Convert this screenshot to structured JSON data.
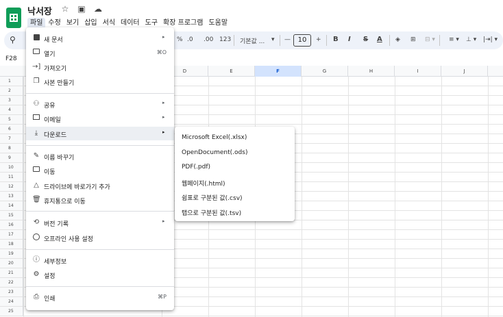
{
  "app": {
    "title": "낙서장",
    "menubar": [
      "파일",
      "수정",
      "보기",
      "삽입",
      "서식",
      "데이터",
      "도구",
      "확장 프로그램",
      "도움말"
    ],
    "active_menu": "파일"
  },
  "toolbar": {
    "percent": "%",
    "dec_decrease": ".0",
    "dec_increase": ".00",
    "number_format": "123",
    "font_name": "기본값 ...",
    "font_minus": "—",
    "font_size": "10",
    "font_plus": "+",
    "bold": "B",
    "italic": "I",
    "strike": "S",
    "text_color": "A"
  },
  "namebox": {
    "value": "F28"
  },
  "columns": [
    "D",
    "E",
    "F",
    "G",
    "H",
    "I",
    "J"
  ],
  "selected_column": "F",
  "rows": [
    "1",
    "2",
    "3",
    "4",
    "5",
    "6",
    "7",
    "8",
    "9",
    "10",
    "11",
    "12",
    "13",
    "14",
    "15",
    "16",
    "17",
    "18",
    "19",
    "20",
    "21",
    "22",
    "23",
    "24",
    "25"
  ],
  "file_menu": {
    "items": [
      {
        "label": "새 문서",
        "icon": "new-doc-icon",
        "submenu": true
      },
      {
        "label": "열기",
        "icon": "folder-icon",
        "shortcut": "⌘O"
      },
      {
        "label": "가져오기",
        "icon": "import-icon"
      },
      {
        "label": "사본 만들기",
        "icon": "copy-icon"
      },
      {
        "label": "공유",
        "icon": "share-icon",
        "submenu": true
      },
      {
        "label": "이메일",
        "icon": "email-icon",
        "submenu": true
      },
      {
        "label": "다운로드",
        "icon": "download-icon",
        "submenu": true
      },
      {
        "label": "이름 바꾸기",
        "icon": "rename-icon"
      },
      {
        "label": "이동",
        "icon": "move-icon"
      },
      {
        "label": "드라이브에 바로가기 추가",
        "icon": "drive-shortcut-icon"
      },
      {
        "label": "휴지통으로 이동",
        "icon": "trash-icon"
      },
      {
        "label": "버전 기록",
        "icon": "history-icon",
        "submenu": true
      },
      {
        "label": "오프라인 사용 설정",
        "icon": "offline-icon"
      },
      {
        "label": "세부정보",
        "icon": "info-icon"
      },
      {
        "label": "설정",
        "icon": "settings-icon"
      },
      {
        "label": "인쇄",
        "icon": "print-icon",
        "shortcut": "⌘P"
      }
    ]
  },
  "download_menu": {
    "items": [
      "Microsoft Excel(.xlsx)",
      "OpenDocument(.ods)",
      "PDF(.pdf)",
      "웹페이지(.html)",
      "쉼표로 구분된 값(.csv)",
      "탭으로 구분된 값(.tsv)"
    ]
  }
}
